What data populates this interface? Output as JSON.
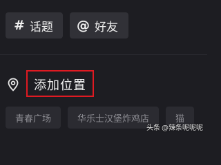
{
  "hashtag_chip": {
    "icon": "hash-icon",
    "icon_glyph": "#",
    "label": "话题"
  },
  "friend_chip": {
    "icon": "at-icon",
    "icon_glyph": "@",
    "label": "好友"
  },
  "location": {
    "icon": "location-pin-icon",
    "label": "添加位置",
    "highlight_color": "#e01a22"
  },
  "suggestions": [
    {
      "label": "青春广场"
    },
    {
      "label": "华乐士汉堡炸鸡店"
    },
    {
      "label": "猫"
    }
  ],
  "watermark": {
    "brand": "头条",
    "handle": "@辣条呢呢呢"
  },
  "colors": {
    "background": "#1d1d22",
    "chip": "#313137",
    "suggestion_chip": "#2b2b31",
    "suggestion_text": "#8d8d93"
  }
}
